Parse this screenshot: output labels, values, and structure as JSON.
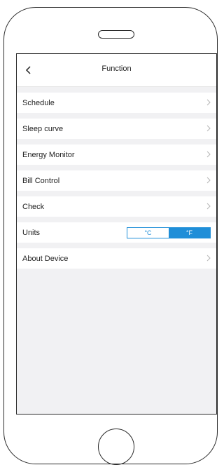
{
  "nav": {
    "title": "Function",
    "back_icon": "chevron-left-icon"
  },
  "menu": {
    "items": [
      {
        "label": "Schedule",
        "icon": "chevron-right-icon"
      },
      {
        "label": "Sleep curve",
        "icon": "chevron-right-icon"
      },
      {
        "label": "Energy Monitor",
        "icon": "chevron-right-icon"
      },
      {
        "label": "Bill Control",
        "icon": "chevron-right-icon"
      },
      {
        "label": "Check",
        "icon": "chevron-right-icon"
      }
    ]
  },
  "units": {
    "label": "Units",
    "options": [
      "°C",
      "°F"
    ],
    "selected": "°F"
  },
  "about": {
    "label": "About Device",
    "icon": "chevron-right-icon"
  },
  "colors": {
    "accent": "#1f8ed8",
    "screen_background": "#f1f1f3"
  }
}
